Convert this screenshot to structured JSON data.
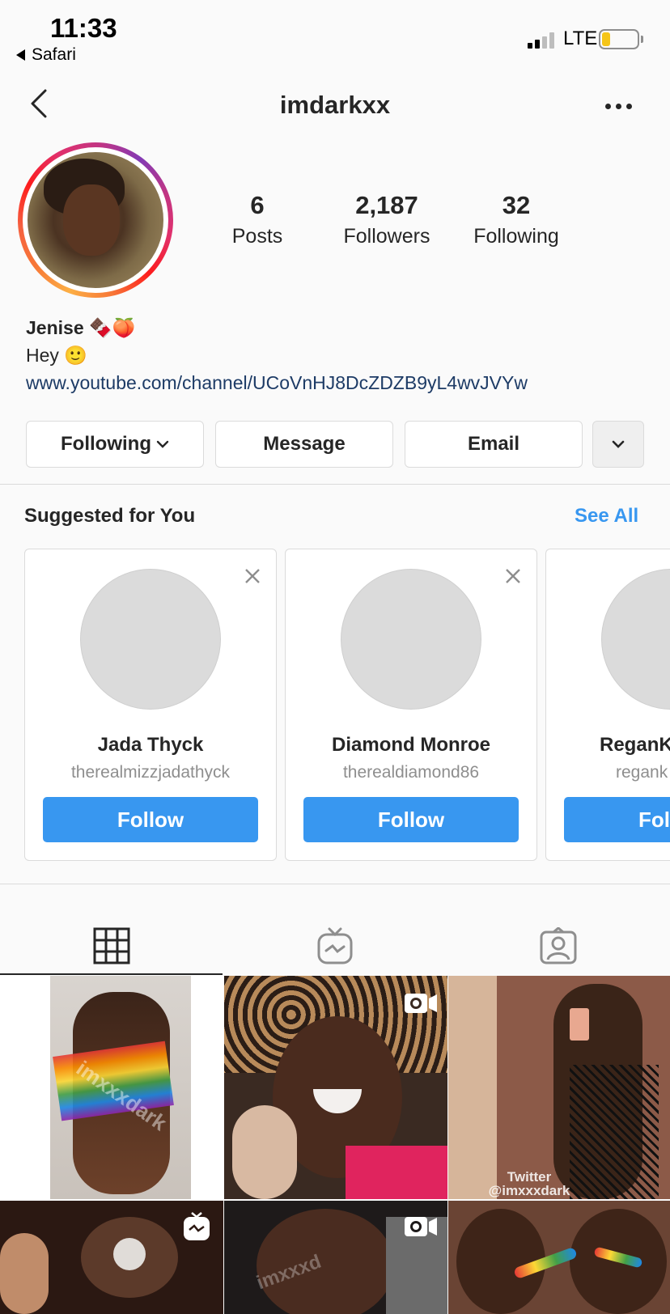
{
  "status_bar": {
    "time": "11:33",
    "back_app": "Safari",
    "network": "LTE"
  },
  "header": {
    "username": "imdarkxx"
  },
  "profile": {
    "stats": [
      {
        "value": "6",
        "label": "Posts"
      },
      {
        "value": "2,187",
        "label": "Followers"
      },
      {
        "value": "32",
        "label": "Following"
      }
    ],
    "name": "Jenise 🍫🍑",
    "bio": "Hey 🙂",
    "link": "www.youtube.com/channel/UCoVnHJ8DcZDZB9yL4wvJVYw"
  },
  "actions": {
    "following": "Following",
    "message": "Message",
    "email": "Email"
  },
  "suggested": {
    "title": "Suggested for You",
    "see_all": "See All",
    "cards": [
      {
        "name": "Jada Thyck",
        "handle": "therealmizzjadathyck",
        "button": "Follow"
      },
      {
        "name": "Diamond Monroe",
        "handle": "therealdiamond86",
        "button": "Follow"
      },
      {
        "name": "ReganK",
        "handle": "regank",
        "button": "Follow"
      }
    ]
  },
  "tabs": [
    "posts-grid",
    "igtv",
    "tagged"
  ],
  "grid": {
    "watermarks": {
      "tile1": "imxxxdark",
      "tile3": "Twitter\n@imxxxdark",
      "tile5": "imxxxd"
    }
  },
  "colors": {
    "accent": "#3897f0",
    "link": "#1d3b66",
    "battery": "#f5c518"
  }
}
